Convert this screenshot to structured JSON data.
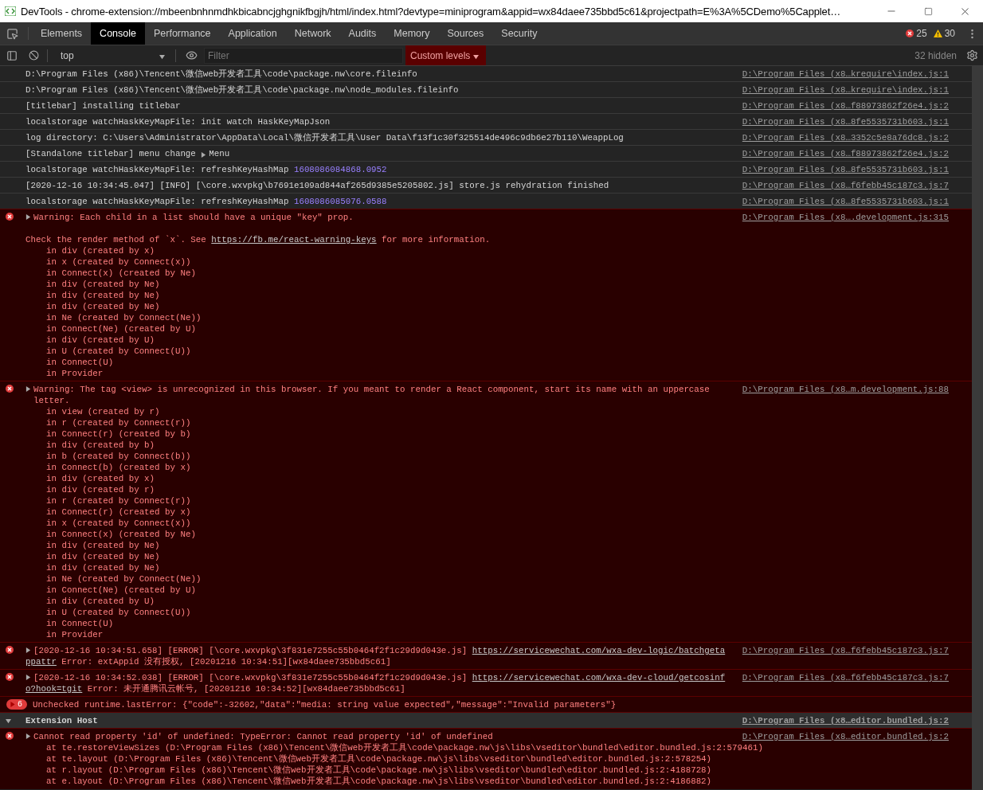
{
  "window": {
    "title": "DevTools - chrome-extension://mbeenbnhnmdhkbicabncjghgnikfbgjh/html/index.html?devtype=miniprogram&appid=wx84daee735bbd5c61&projectpath=E%3A%5CDemo%5Capplet…"
  },
  "tabs": [
    {
      "label": "Elements",
      "selected": false
    },
    {
      "label": "Console",
      "selected": true
    },
    {
      "label": "Performance",
      "selected": false
    },
    {
      "label": "Application",
      "selected": false
    },
    {
      "label": "Network",
      "selected": false
    },
    {
      "label": "Audits",
      "selected": false
    },
    {
      "label": "Memory",
      "selected": false
    },
    {
      "label": "Sources",
      "selected": false
    },
    {
      "label": "Security",
      "selected": false
    }
  ],
  "counts": {
    "errors": "25",
    "warnings": "30"
  },
  "toolbar": {
    "context": "top",
    "filter_placeholder": "Filter",
    "levels": "Custom levels",
    "hidden": "32 hidden"
  },
  "messages": [
    {
      "kind": "log",
      "lines": [
        {
          "segments": [
            {
              "text": "D:\\Program Files (x86)\\Tencent\\微信web开发者工具\\code\\package.nw\\core.fileinfo"
            }
          ]
        }
      ],
      "source": "D:\\Program Files (x8…krequire\\index.js:1"
    },
    {
      "kind": "log",
      "lines": [
        {
          "segments": [
            {
              "text": "D:\\Program Files (x86)\\Tencent\\微信web开发者工具\\code\\package.nw\\node_modules.fileinfo"
            }
          ]
        }
      ],
      "source": "D:\\Program Files (x8…krequire\\index.js:1"
    },
    {
      "kind": "log",
      "lines": [
        {
          "segments": [
            {
              "text": "[titlebar] installing titlebar"
            }
          ]
        }
      ],
      "source": "D:\\Program Files (x8…f88973862f26e4.js:2"
    },
    {
      "kind": "log",
      "lines": [
        {
          "segments": [
            {
              "text": "localstorage watchHaskKeyMapFile: init watch HaskKeyMapJson"
            }
          ]
        }
      ],
      "source": "D:\\Program Files (x8…8fe5535731b603.js:1"
    },
    {
      "kind": "log",
      "lines": [
        {
          "segments": [
            {
              "text": "log directory: C:\\Users\\Administrator\\AppData\\Local\\微信开发者工具\\User Data\\f13f1c30f325514de496c9db6e27b110\\WeappLog"
            }
          ]
        }
      ],
      "source": "D:\\Program Files (x8…3352c5e8a76dc8.js:2"
    },
    {
      "kind": "log",
      "lines": [
        {
          "segments": [
            {
              "text": "[Standalone titlebar] menu change "
            },
            {
              "kind": "object",
              "text": "Menu"
            }
          ]
        }
      ],
      "source": "D:\\Program Files (x8…f88973862f26e4.js:2"
    },
    {
      "kind": "log",
      "lines": [
        {
          "segments": [
            {
              "text": "localstorage watchHaskKeyMapFile: refreshKeyHashMap "
            },
            {
              "kind": "number",
              "text": "1608086084868.0952"
            }
          ]
        }
      ],
      "source": "D:\\Program Files (x8…8fe5535731b603.js:1"
    },
    {
      "kind": "log",
      "lines": [
        {
          "segments": [
            {
              "text": "[2020-12-16 10:34:45.047] [INFO] [\\core.wxvpkg\\b7691e109ad844af265d9385e5205802.js] store.js rehydration finished"
            }
          ]
        }
      ],
      "source": "D:\\Program Files (x8…f6febb45c187c3.js:7"
    },
    {
      "kind": "log",
      "lines": [
        {
          "segments": [
            {
              "text": "localstorage watchHaskKeyMapFile: refreshKeyHashMap "
            },
            {
              "kind": "number",
              "text": "1608086085076.0588"
            }
          ]
        }
      ],
      "source": "D:\\Program Files (x8…8fe5535731b603.js:1"
    },
    {
      "kind": "error",
      "expandable": true,
      "lines": [
        {
          "segments": [
            {
              "text": "Warning: Each child in a list should have a unique \"key\" prop."
            }
          ]
        },
        {
          "spaced": true,
          "segments": [
            {
              "text": "Check the render method of `x`. See "
            },
            {
              "kind": "link",
              "text": "https://fb.me/react-warning-keys"
            },
            {
              "text": " for more information."
            }
          ]
        }
      ],
      "stack": [
        "in div (created by x)",
        "in x (created by Connect(x))",
        "in Connect(x) (created by Ne)",
        "in div (created by Ne)",
        "in div (created by Ne)",
        "in div (created by Ne)",
        "in Ne (created by Connect(Ne))",
        "in Connect(Ne) (created by U)",
        "in div (created by U)",
        "in U (created by Connect(U))",
        "in Connect(U)",
        "in Provider"
      ],
      "source": "D:\\Program Files (x8….development.js:315"
    },
    {
      "kind": "error",
      "expandable": true,
      "lines": [
        {
          "segments": [
            {
              "text": "Warning: The tag <view> is unrecognized in this browser. If you meant to render a React component, start its name with an uppercase letter."
            }
          ]
        }
      ],
      "stack": [
        "in view (created by r)",
        "in r (created by Connect(r))",
        "in Connect(r) (created by b)",
        "in div (created by b)",
        "in b (created by Connect(b))",
        "in Connect(b) (created by x)",
        "in div (created by x)",
        "in div (created by r)",
        "in r (created by Connect(r))",
        "in Connect(r) (created by x)",
        "in x (created by Connect(x))",
        "in Connect(x) (created by Ne)",
        "in div (created by Ne)",
        "in div (created by Ne)",
        "in div (created by Ne)",
        "in Ne (created by Connect(Ne))",
        "in Connect(Ne) (created by U)",
        "in div (created by U)",
        "in U (created by Connect(U))",
        "in Connect(U)",
        "in Provider"
      ],
      "source": "D:\\Program Files (x8…m.development.js:88"
    },
    {
      "kind": "error",
      "expandable": true,
      "lines": [
        {
          "segments": [
            {
              "text": "[2020-12-16 10:34:51.658] [ERROR] [\\core.wxvpkg\\3f831e7255c55b0464f2f1c29d9d043e.js] "
            },
            {
              "kind": "link",
              "text": "https://servicewechat.com/wxa-dev-logic/batchgeta"
            }
          ]
        },
        {
          "segments": [
            {
              "kind": "link",
              "text": "ppattr"
            },
            {
              "text": " Error: extAppid 没有授权, [20201216 10:34:51][wx84daee735bbd5c61]"
            }
          ]
        }
      ],
      "source": "D:\\Program Files (x8…f6febb45c187c3.js:7"
    },
    {
      "kind": "error",
      "expandable": true,
      "lines": [
        {
          "segments": [
            {
              "text": "[2020-12-16 10:34:52.038] [ERROR] [\\core.wxvpkg\\3f831e7255c55b0464f2f1c29d9d043e.js] "
            },
            {
              "kind": "link",
              "text": "https://servicewechat.com/wxa-dev-cloud/getcosinf"
            }
          ]
        },
        {
          "segments": [
            {
              "kind": "link",
              "text": "o?hook=tgit"
            },
            {
              "text": " Error: 未开通腾讯云帐号, [20201216 10:34:52][wx84daee735bbd5c61]"
            }
          ]
        }
      ],
      "source": "D:\\Program Files (x8…f6febb45c187c3.js:7"
    },
    {
      "kind": "error",
      "expandable": false,
      "count": "6",
      "lines": [
        {
          "segments": [
            {
              "text": "Unchecked runtime.lastError: {\"code\":-32602,\"data\":\"media: string value expected\",\"message\":\"Invalid parameters\"}"
            }
          ]
        }
      ]
    },
    {
      "kind": "group",
      "title": "Extension Host",
      "expanded": true,
      "source": "D:\\Program Files (x8…editor.bundled.js:2",
      "children": [
        {
          "kind": "error",
          "expandable": true,
          "lines": [
            {
              "segments": [
                {
                  "text": "Cannot read property 'id' of undefined: TypeError: Cannot read property 'id' of undefined"
                }
              ]
            }
          ],
          "stack": [
            "at te.restoreViewSizes (D:\\Program Files (x86)\\Tencent\\微信web开发者工具\\code\\package.nw\\js\\libs\\vseditor\\bundled\\editor.bundled.js:2:579461)",
            "at te.layout (D:\\Program Files (x86)\\Tencent\\微信web开发者工具\\code\\package.nw\\js\\libs\\vseditor\\bundled\\editor.bundled.js:2:578254)",
            "at r.layout (D:\\Program Files (x86)\\Tencent\\微信web开发者工具\\code\\package.nw\\js\\libs\\vseditor\\bundled\\editor.bundled.js:2:4188728)",
            "at e.layout (D:\\Program Files (x86)\\Tencent\\微信web开发者工具\\code\\package.nw\\js\\libs\\vseditor\\bundled\\editor.bundled.js:2:4186882)"
          ],
          "source": "D:\\Program Files (x8…editor.bundled.js:2"
        }
      ]
    }
  ]
}
